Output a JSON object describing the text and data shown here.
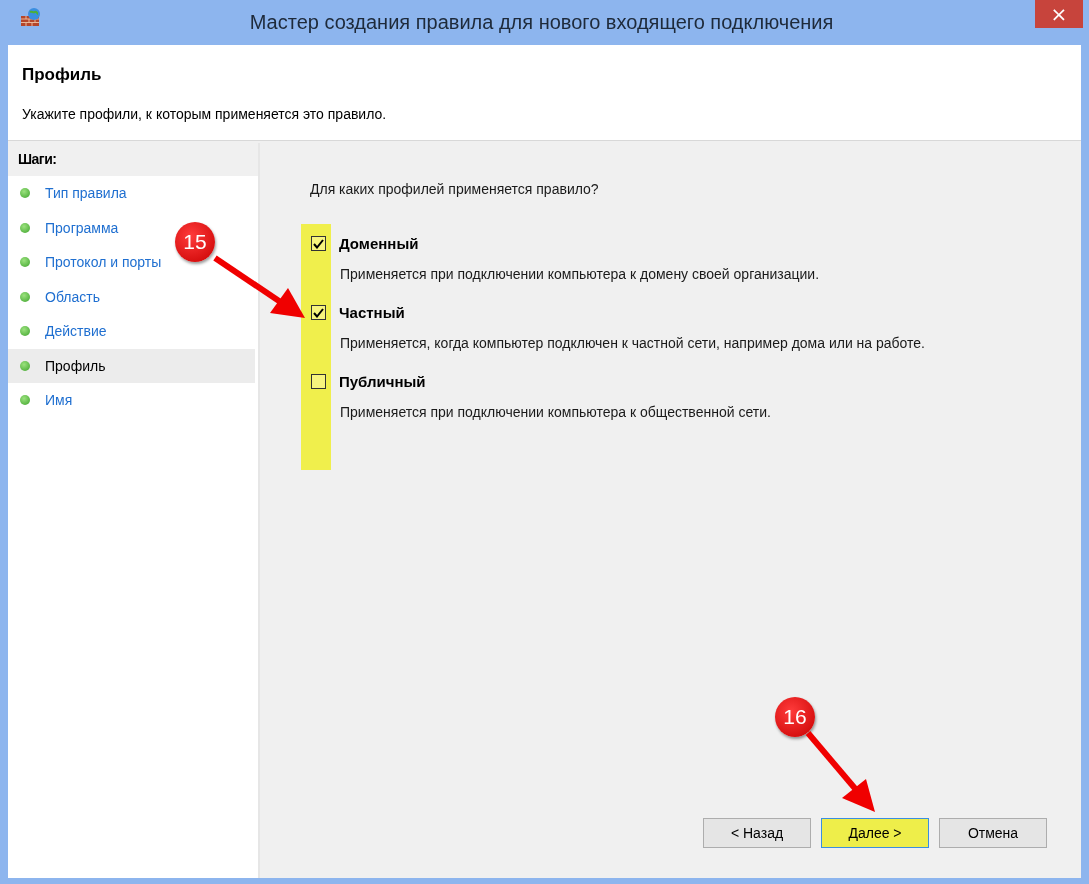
{
  "window": {
    "title": "Мастер создания правила для нового входящего подключения",
    "close": "×"
  },
  "header": {
    "title": "Профиль",
    "subtitle": "Укажите профили, к которым применяется это правило."
  },
  "steps": {
    "heading": "Шаги:",
    "items": [
      {
        "label": "Тип правила",
        "selected": false
      },
      {
        "label": "Программа",
        "selected": false
      },
      {
        "label": "Протокол и порты",
        "selected": false
      },
      {
        "label": "Область",
        "selected": false
      },
      {
        "label": "Действие",
        "selected": false
      },
      {
        "label": "Профиль",
        "selected": true
      },
      {
        "label": "Имя",
        "selected": false
      }
    ]
  },
  "question": "Для каких профилей применяется правило?",
  "profiles": {
    "highlighted": true,
    "items": [
      {
        "label": "Доменный",
        "checked": true,
        "description": "Применяется при подключении компьютера к домену своей организации."
      },
      {
        "label": "Частный",
        "checked": true,
        "description": "Применяется, когда компьютер подключен к частной сети, например дома или на работе."
      },
      {
        "label": "Публичный",
        "checked": false,
        "description": "Применяется при подключении компьютера к общественной сети."
      }
    ]
  },
  "buttons": [
    {
      "label": "< Назад",
      "highlighted": false
    },
    {
      "label": "Далее >",
      "highlighted": true
    },
    {
      "label": "Отмена",
      "highlighted": false
    }
  ],
  "annotations": [
    {
      "label": "15"
    },
    {
      "label": "16"
    }
  ]
}
